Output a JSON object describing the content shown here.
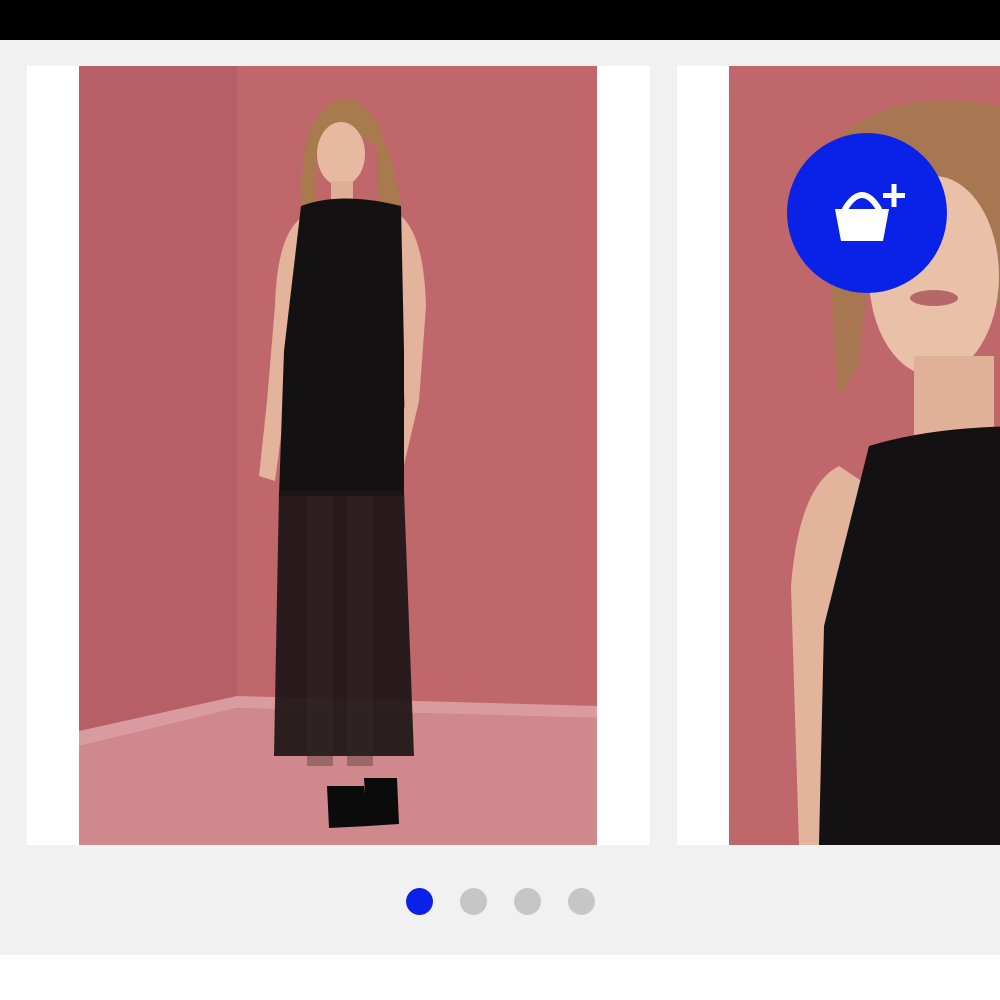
{
  "colors": {
    "accent": "#0a22e8",
    "inactive_dot": "#c6c6c6",
    "backdrop": "#c0676c",
    "floor": "#cf888b",
    "dress": "#0f0d0e",
    "top_bar": "#000000",
    "gallery_background": "#f1f1f1"
  },
  "gallery": {
    "slides": [
      {
        "image": "model-full-length-black-lace-maxi-dress"
      },
      {
        "image": "model-closeup-black-lace-bodice"
      }
    ],
    "add_to_basket_icon": "shopping-basket-plus-icon",
    "pagination": {
      "total": 4,
      "current": 1
    }
  }
}
